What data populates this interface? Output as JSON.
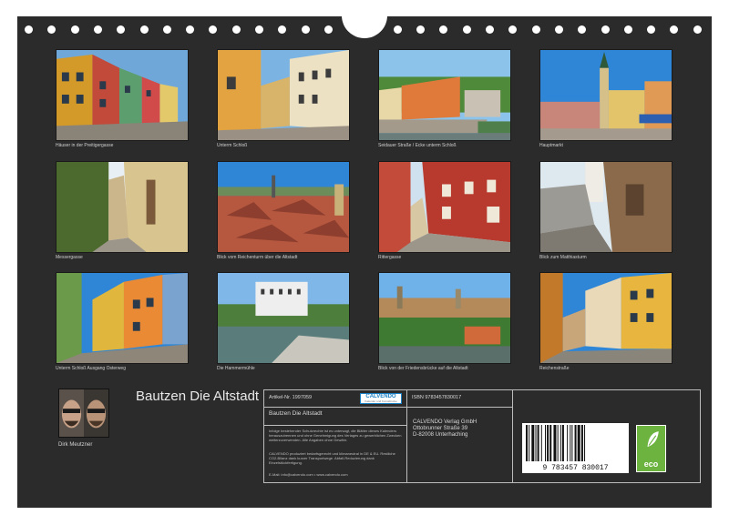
{
  "calendar": {
    "title": "Bautzen Die Altstadt",
    "author": "Dirk Meutzner"
  },
  "photos": [
    {
      "caption": "Häuser in der Preitigergasse",
      "icon": "colorful-houses-photo"
    },
    {
      "caption": "Unterm Schloß",
      "icon": "old-town-street-photo"
    },
    {
      "caption": "Seidauer Straße / Ecke unterm Schloß",
      "icon": "river-houses-photo"
    },
    {
      "caption": "Hauptmarkt",
      "icon": "market-square-photo"
    },
    {
      "caption": "Messergasse",
      "icon": "narrow-alley-photo"
    },
    {
      "caption": "Blick vom Reichenturm über die Altstadt",
      "icon": "rooftops-view-photo"
    },
    {
      "caption": "Rittergasse",
      "icon": "red-facade-photo"
    },
    {
      "caption": "Blick zum Matthiasturm",
      "icon": "castle-wall-photo"
    },
    {
      "caption": "Unterm Schloß Ausgang Osterweg",
      "icon": "curved-street-photo"
    },
    {
      "caption": "Die Hammermühle",
      "icon": "mill-weir-photo"
    },
    {
      "caption": "Blick von der Friedensbrücke auf die Altstadt",
      "icon": "city-panorama-photo"
    },
    {
      "caption": "Reichenstraße",
      "icon": "shopping-street-photo"
    }
  ],
  "info": {
    "article_label": "Artikel-Nr. 1997059",
    "product_title": "Bautzen Die Altstadt",
    "legal_text": "Infolge bestehender Schutzrechte ist es untersagt, die Blätter dieses Kalenders herauszutrennen und ohne Genehmigung des Verlages zu gewerblichen Zwecken weiterzuverwenden. Alle Angaben ohne Gewähr.",
    "production_text": "CALVENDO produziert bedarfsgerecht und klimaneutral in DE & EU. Restliche CO2-Bilanz dank kurzer Transportwege. Abfall-Reduzierung dank Einzelstückfertigung.",
    "email_line": "E-Mail: info@calvendo.com • www.calvendo.com",
    "calvendo_logo": "CALVENDO",
    "calvendo_sub": "Kalender und Kunstdrucke",
    "isbn": "ISBN 9783457830017",
    "publisher_lines": [
      "CALVENDO Verlag GmbH",
      "Ottobrunner Straße 39",
      "D-82008 Unterhaching"
    ],
    "barcode_digits": "9 783457 830017",
    "eco_label": "eco"
  },
  "colors": {
    "background": "#2b2b2b",
    "eco_green": "#6db33f",
    "calvendo_blue": "#1b7fc4"
  }
}
